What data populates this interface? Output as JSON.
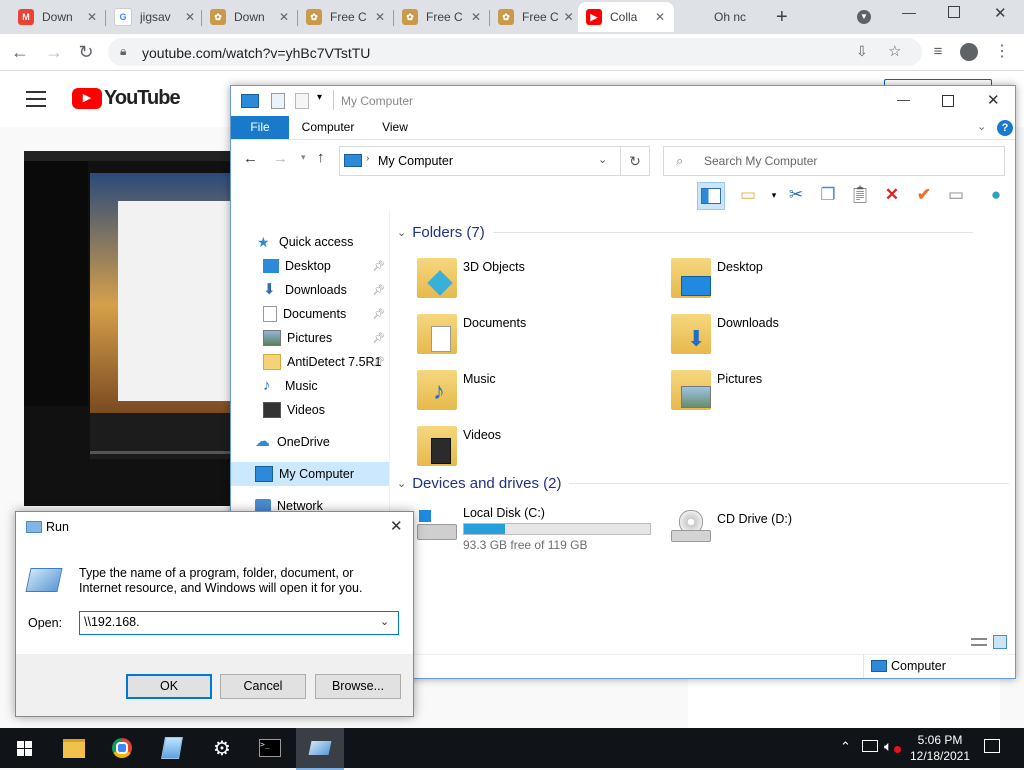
{
  "browser": {
    "tabs": [
      {
        "title": "Down",
        "icon": "gmail-icon"
      },
      {
        "title": "jigsav",
        "icon": "google-icon"
      },
      {
        "title": "Down",
        "icon": "jigsaw-icon"
      },
      {
        "title": "Free C",
        "icon": "jigsaw-icon"
      },
      {
        "title": "Free C",
        "icon": "jigsaw-icon"
      },
      {
        "title": "Free C",
        "icon": "jigsaw-icon"
      },
      {
        "title": "Colla",
        "icon": "youtube-icon"
      },
      {
        "title": "Oh nc",
        "icon": "blank"
      }
    ],
    "url": "youtube.com/watch?v=yhBc7VTstTU"
  },
  "youtube": {
    "logo_text": "YouTube"
  },
  "explorer": {
    "title": "My Computer",
    "ribbon_tabs": [
      "File",
      "Computer",
      "View"
    ],
    "address": "My Computer",
    "search_placeholder": "Search My Computer",
    "nav": {
      "quick_access": "Quick access",
      "items": [
        "Desktop",
        "Downloads",
        "Documents",
        "Pictures",
        "AntiDetect 7.5R1",
        "Music",
        "Videos"
      ],
      "onedrive": "OneDrive",
      "mycomputer": "My Computer",
      "network": "Network"
    },
    "folders_header": "Folders (7)",
    "folders": [
      "3D Objects",
      "Desktop",
      "Documents",
      "Downloads",
      "Music",
      "Pictures",
      "Videos"
    ],
    "drives_header": "Devices and drives (2)",
    "drives": [
      {
        "name": "Local Disk (C:)",
        "free": "93.3 GB free of 119 GB",
        "used_fraction": 0.22
      },
      {
        "name": "CD Drive (D:)"
      }
    ],
    "status": "Computer"
  },
  "run": {
    "title": "Run",
    "description": "Type the name of a program, folder, document, or Internet resource, and Windows will open it for you.",
    "open_label": "Open:",
    "value": "\\\\192.168.",
    "ok": "OK",
    "cancel": "Cancel",
    "browse": "Browse..."
  },
  "taskbar": {
    "time": "5:06 PM",
    "date": "12/18/2021"
  }
}
